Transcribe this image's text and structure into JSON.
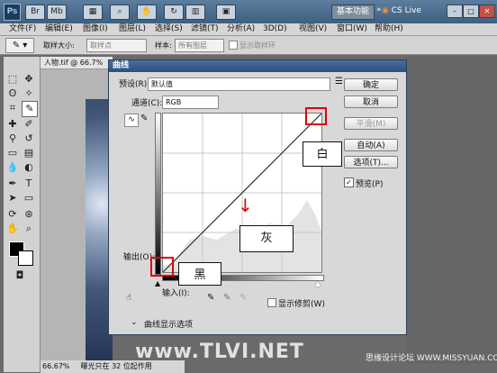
{
  "app": {
    "logo": "Ps",
    "workspace": "基本功能",
    "cslive": "CS Live"
  },
  "menu": [
    "文件(F)",
    "编辑(E)",
    "图像(I)",
    "图层(L)",
    "选择(S)",
    "滤镜(T)",
    "分析(A)",
    "3D(D)",
    "视图(V)",
    "窗口(W)",
    "帮助(H)"
  ],
  "options": {
    "sample_size_label": "取样大小:",
    "sample_size_value": "取样点",
    "sample_label": "样本:",
    "sample_value": "所有图层",
    "show_ring": "显示取样环"
  },
  "document": {
    "tab": "人物.tif @ 66.7%",
    "zoom": "66.67%",
    "status": "曝光只在 32 位起作用"
  },
  "dialog": {
    "title": "曲线",
    "preset_label": "预设(R):",
    "preset_value": "默认值",
    "channel_label": "通道(C):",
    "channel_value": "RGB",
    "output_label": "输出(O):",
    "input_label": "输入(I):",
    "show_clipping": "显示修剪(W)",
    "display_options": "曲线显示选项",
    "buttons": {
      "ok": "确定",
      "cancel": "取消",
      "smooth": "平滑(M)",
      "auto": "自动(A)",
      "options": "选项(T)...",
      "preview": "预览(P)"
    }
  },
  "annotations": {
    "white": "白",
    "gray": "灰",
    "black": "黑"
  },
  "watermark": "www.TLVI.NET",
  "site_label": "思缘设计论坛 WWW.MISSYUAN.COM",
  "colors": {
    "title_bar": "#4a6b8c",
    "dialog_title": "#2d4f7f",
    "highlight_red": "#e00000"
  }
}
